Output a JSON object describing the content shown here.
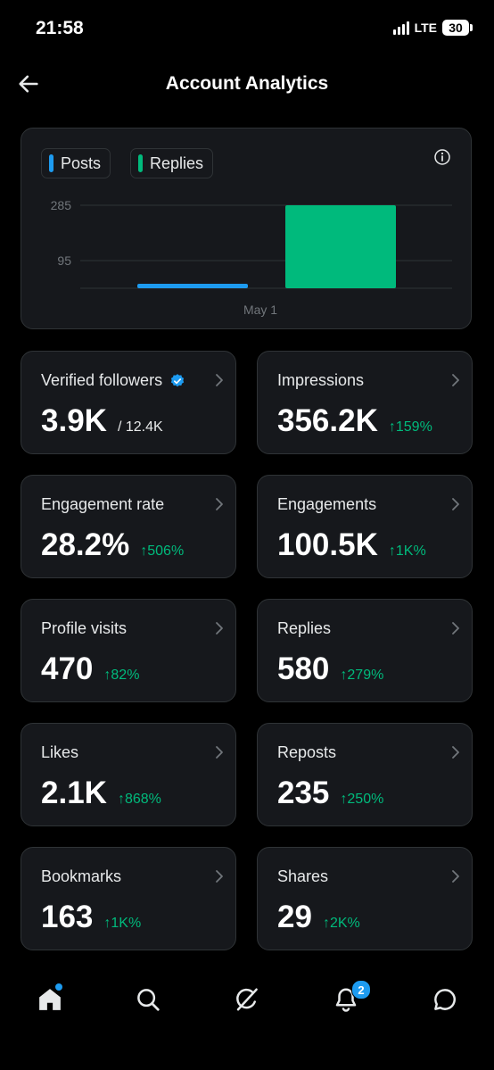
{
  "status_bar": {
    "time": "21:58",
    "network": "LTE",
    "battery": "30"
  },
  "header": {
    "title": "Account Analytics"
  },
  "chart_data": {
    "type": "bar",
    "categories": [
      "May 1"
    ],
    "series": [
      {
        "name": "Posts",
        "values": [
          3
        ],
        "color": "#1d9bf0"
      },
      {
        "name": "Replies",
        "values": [
          285
        ],
        "color": "#00ba7c"
      }
    ],
    "y_ticks": [
      95,
      285
    ],
    "tick_labels": [
      "95",
      "285"
    ],
    "ylim": [
      0,
      285
    ],
    "grid": true,
    "legend": "top-left"
  },
  "legend": [
    {
      "label": "Posts",
      "color": "#1d9bf0"
    },
    {
      "label": "Replies",
      "color": "#00ba7c"
    }
  ],
  "stats": [
    {
      "label": "Verified followers",
      "value": "3.9K",
      "sub": "/ 12.4K",
      "delta": "",
      "verified_icon": true
    },
    {
      "label": "Impressions",
      "value": "356.2K",
      "sub": "",
      "delta": "↑159%"
    },
    {
      "label": "Engagement rate",
      "value": "28.2%",
      "sub": "",
      "delta": "↑506%"
    },
    {
      "label": "Engagements",
      "value": "100.5K",
      "sub": "",
      "delta": "↑1K%"
    },
    {
      "label": "Profile visits",
      "value": "470",
      "sub": "",
      "delta": "↑82%"
    },
    {
      "label": "Replies",
      "value": "580",
      "sub": "",
      "delta": "↑279%"
    },
    {
      "label": "Likes",
      "value": "2.1K",
      "sub": "",
      "delta": "↑868%"
    },
    {
      "label": "Reposts",
      "value": "235",
      "sub": "",
      "delta": "↑250%"
    },
    {
      "label": "Bookmarks",
      "value": "163",
      "sub": "",
      "delta": "↑1K%"
    },
    {
      "label": "Shares",
      "value": "29",
      "sub": "",
      "delta": "↑2K%"
    }
  ],
  "nav": {
    "items": [
      "home-icon",
      "search-icon",
      "grok-icon",
      "bell-icon",
      "messages-icon"
    ],
    "notification_count": "2"
  },
  "colors": {
    "accent": "#1d9bf0",
    "positive": "#00ba7c",
    "card": "#16181c",
    "border": "#2f3336"
  }
}
